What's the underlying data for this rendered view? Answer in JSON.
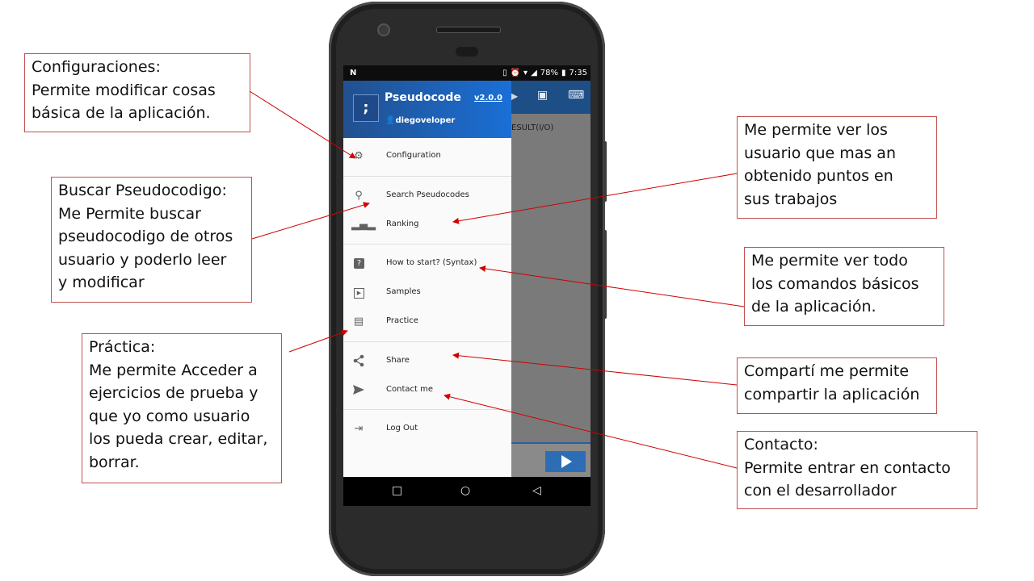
{
  "callouts": {
    "config": "Configuraciones:\nPermite modificar cosas\nbásica de la aplicación.",
    "search": "Buscar Pseudocodigo:\nMe Permite buscar\npseudocodigo de otros\nusuario y poderlo leer\ny modificar",
    "practice": "Práctica:\nMe permite Acceder a\nejercicios de prueba y\nque yo como usuario\nlos pueda  crear, editar,\nborrar.",
    "ranking": "Me permite ver  los\nusuario que mas an\nobtenido puntos en\nsus trabajos",
    "syntax": "Me permite ver todo\nlos  comandos básicos\nde la aplicación.",
    "share": "Compartí me permite\ncompartir la aplicación",
    "contact": "Contacto:\nPermite entrar en contacto\ncon el desarrollador"
  },
  "status_bar": {
    "carrier_icon": "N",
    "battery": "78%",
    "time": "7:35"
  },
  "app": {
    "result_label": "ESULT(I/O)"
  },
  "drawer": {
    "title": "Pseudocode",
    "version": "v2.0.0",
    "user": "diegoveloper",
    "items": [
      {
        "label": "Configuration",
        "icon": "gear-icon"
      },
      {
        "label": "Search Pseudocodes",
        "icon": "search-icon"
      },
      {
        "label": "Ranking",
        "icon": "podium-icon"
      },
      {
        "label": "How to start? (Syntax)",
        "icon": "help-icon"
      },
      {
        "label": "Samples",
        "icon": "play-box-icon"
      },
      {
        "label": "Practice",
        "icon": "library-icon"
      },
      {
        "label": "Share",
        "icon": "share-icon"
      },
      {
        "label": "Contact me",
        "icon": "send-icon"
      },
      {
        "label": "Log Out",
        "icon": "logout-icon"
      }
    ]
  },
  "colors": {
    "callout_border": "#c0504d",
    "arrow": "#d00000",
    "drawer_header_start": "#22508f",
    "drawer_header_end": "#1a6fd6"
  }
}
